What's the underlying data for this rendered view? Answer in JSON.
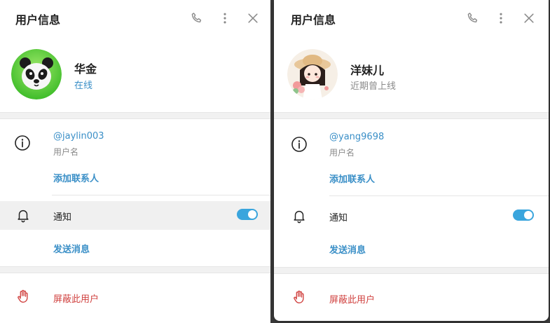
{
  "left": {
    "header": {
      "title": "用户信息"
    },
    "profile": {
      "name": "华金",
      "status": "在线",
      "status_color": "#3a8fc7",
      "avatar": "panda-avatar-icon"
    },
    "info": {
      "username": "@jaylin003",
      "username_caption": "用户名",
      "add_contact": "添加联系人"
    },
    "notifications": {
      "label": "通知",
      "enabled": true
    },
    "send_message": "发送消息",
    "block_user": "屏蔽此用户"
  },
  "right": {
    "header": {
      "title": "用户信息"
    },
    "profile": {
      "name": "洋妹儿",
      "status": "近期曾上线",
      "status_color": "#8a8a8a",
      "avatar": "anime-girl-avatar-icon"
    },
    "info": {
      "username": "@yang9698",
      "username_caption": "用户名",
      "add_contact": "添加联系人"
    },
    "notifications": {
      "label": "通知",
      "enabled": true
    },
    "send_message": "发送消息",
    "block_user": "屏蔽此用户"
  },
  "colors": {
    "link": "#3a8fc7",
    "danger": "#d0413f",
    "toggle_on": "#3aa5dd",
    "separator": "#f1f1f1"
  }
}
